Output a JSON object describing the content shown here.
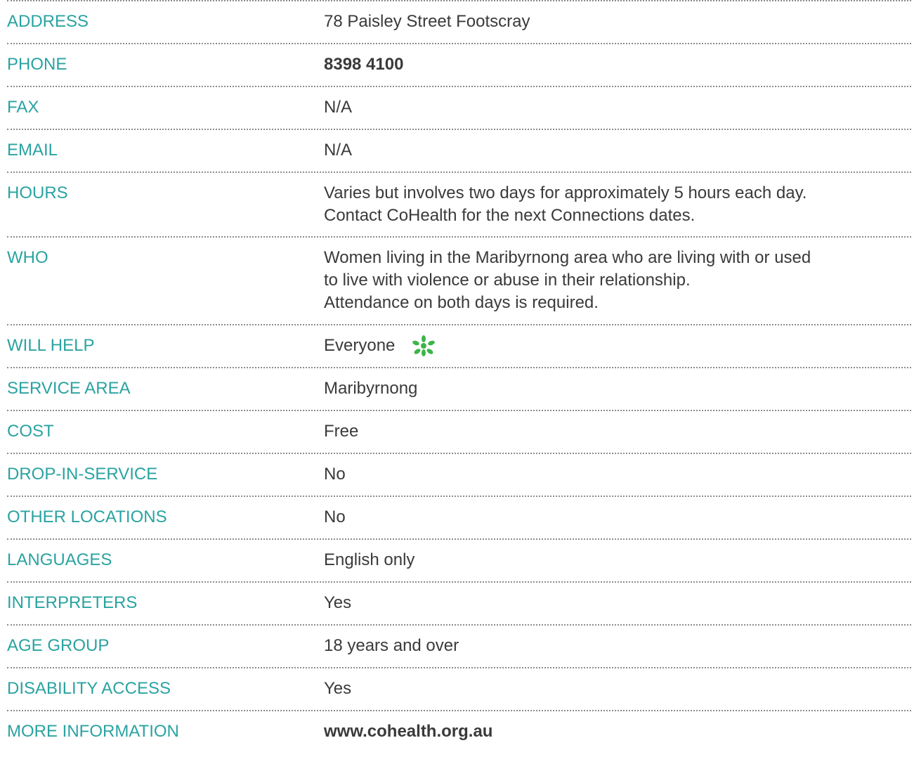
{
  "rows": [
    {
      "label": "ADDRESS",
      "value": "78 Paisley Street Footscray"
    },
    {
      "label": "PHONE",
      "value": "8398 4100"
    },
    {
      "label": "FAX",
      "value": "N/A"
    },
    {
      "label": "EMAIL",
      "value": "N/A"
    },
    {
      "label": "HOURS",
      "lines": [
        "Varies but involves two days for approximately 5 hours each day.",
        "Contact CoHealth for the next Connections dates."
      ]
    },
    {
      "label": "WHO",
      "lines": [
        "Women living in the Maribyrnong area who are living with or used",
        "to live with violence or abuse in their relationship.",
        "Attendance on both days is required."
      ]
    },
    {
      "label": "WILL HELP",
      "value": "Everyone",
      "icon": "green-flower-icon"
    },
    {
      "label": "SERVICE AREA",
      "value": "Maribyrnong"
    },
    {
      "label": "COST",
      "value": "Free"
    },
    {
      "label": "DROP-IN-SERVICE",
      "value": "No"
    },
    {
      "label": "OTHER LOCATIONS",
      "value": "No"
    },
    {
      "label": "LANGUAGES",
      "value": "English only"
    },
    {
      "label": "INTERPRETERS",
      "value": "Yes"
    },
    {
      "label": "AGE GROUP",
      "value": "18 years and over"
    },
    {
      "label": "DISABILITY ACCESS",
      "value": "Yes"
    },
    {
      "label": "MORE INFORMATION",
      "value": "www.cohealth.org.au"
    }
  ],
  "colors": {
    "label": "#2aa3a1",
    "value": "#3a3a3a",
    "icon": "#3cb54a",
    "separator": "#8c8c8c"
  }
}
